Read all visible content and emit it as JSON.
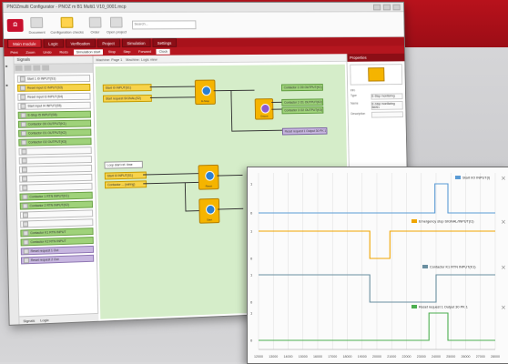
{
  "app": {
    "title": "PNOZmulti Configurator - PNOZ m B1 Multi1 V10_0001.mcp",
    "ribbon": {
      "groups": [
        {
          "label": "Document"
        },
        {
          "label": "Configuration checks"
        },
        {
          "label": "Order"
        },
        {
          "label": "Open project"
        }
      ],
      "search_placeholder": "Search..."
    },
    "tabs": [
      {
        "label": "Main module"
      },
      {
        "label": "Logic"
      },
      {
        "label": "Verification"
      },
      {
        "label": "Project"
      },
      {
        "label": "Simulation"
      },
      {
        "label": "Settings"
      }
    ],
    "toolbar": [
      "Print",
      "Zoom",
      "Undo",
      "Redo",
      "Simulation start",
      "Stop",
      "Step",
      "Forward",
      "Clock"
    ],
    "left_panel": {
      "title": "Signals",
      "footer_tabs": [
        "Signals",
        "Logic"
      ],
      "items": [
        {
          "label": "Start 1 I0 INPUT(S1)",
          "color": "white"
        },
        {
          "label": "Reset input I2 INPUT(S3)",
          "color": "yellow"
        },
        {
          "label": "Reset input I3 INPUT(S4)",
          "color": "white"
        },
        {
          "label": "Start input I4 INPUT(S5)",
          "color": "white"
        },
        {
          "label": "E-Stop I5 INPUT(S6)",
          "color": "green"
        },
        {
          "label": "Contactor O0 OUTPUT(K1)",
          "color": "green"
        },
        {
          "label": "Contactor O1 OUTPUT(K2)",
          "color": "green"
        },
        {
          "label": "Contactor O2 OUTPUT(K3)",
          "color": "green"
        },
        {
          "label": "",
          "color": "white"
        },
        {
          "label": "",
          "color": "white"
        },
        {
          "label": "",
          "color": "white"
        },
        {
          "label": "",
          "color": "white"
        },
        {
          "label": "",
          "color": "white"
        },
        {
          "label": "Contactor 1 RTN INPUT(K1)",
          "color": "green"
        },
        {
          "label": "Contactor 2 RTN INPUT(K2)",
          "color": "green"
        },
        {
          "label": "",
          "color": "white"
        },
        {
          "label": "",
          "color": "white"
        },
        {
          "label": "Contactor K1 RTN INPUT",
          "color": "green"
        },
        {
          "label": "Contactor K2 RTN INPUT",
          "color": "green"
        },
        {
          "label": "Reset request 1 Out",
          "color": "purple"
        },
        {
          "label": "Reset request 2 Out",
          "color": "purple"
        }
      ]
    },
    "canvas": {
      "tabs": [
        "Machine: Page 1",
        "Machine: Logic view"
      ],
      "labels_left": [
        "Start I0 INPUT(S1)",
        "Start request SIGNAL(S2)",
        "Loop start ref. time",
        "Start I0 INPUT(S1)",
        "Contactor ... (wiring)"
      ],
      "labels_right": [
        "Contactor 1 O0 OUTPUT(K1)",
        "Contactor 2 O1 OUTPUT(K2)",
        "Contactor 3 O2 OUTPUT(K3)",
        "Reset request 1 Output 30 PK 1"
      ],
      "blocks": [
        "E-Stop",
        "Reset",
        "Start",
        "Safety gate",
        "Output"
      ]
    },
    "properties": {
      "title": "Properties",
      "section": "Info",
      "rows": [
        {
          "k": "Type",
          "v": "E-Stop monitoring"
        },
        {
          "k": "Name",
          "v": "E-Stop monitoring BDS1"
        },
        {
          "k": "Description",
          "v": ""
        }
      ]
    }
  },
  "scope": {
    "channels": [
      {
        "label": "Start I/O INPUT(I)",
        "color": "#5a9bd5"
      },
      {
        "label": "Emergency stop SIGNAL/INPUT(I1)",
        "color": "#f0a500"
      },
      {
        "label": "Contactor K1 RTN INPUT(K1)",
        "color": "#6a8fa0"
      },
      {
        "label": "Reset request 1 Output 30 PK 1",
        "color": "#4caf50"
      }
    ],
    "time_labels": [
      "12000",
      "13000",
      "14000",
      "15000",
      "16000",
      "17000",
      "18000",
      "19000",
      "20000",
      "21000",
      "22000",
      "23000",
      "24000",
      "25000",
      "26000",
      "27000",
      "28000"
    ],
    "level_labels": [
      "1",
      "0",
      "1",
      "0",
      "1",
      "0",
      "1",
      "0"
    ]
  },
  "colors": {
    "brand_red": "#b8121c",
    "signal_yellow": "#f7d34a",
    "signal_green": "#9fd27a",
    "canvas_green": "#d5edc9"
  }
}
